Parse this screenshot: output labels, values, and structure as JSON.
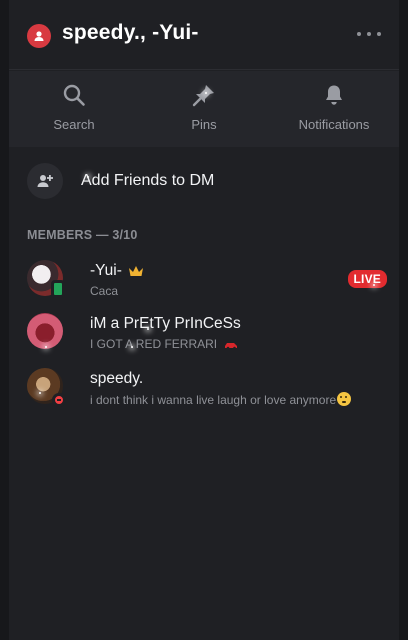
{
  "header": {
    "title": "speedy., -Yui-",
    "group_icon": "group-dm-icon",
    "more_icon": "more-options-icon"
  },
  "actions": [
    {
      "label": "Search",
      "icon": "search-icon"
    },
    {
      "label": "Pins",
      "icon": "pin-icon"
    },
    {
      "label": "Notifications",
      "icon": "bell-icon"
    }
  ],
  "add_friends": {
    "label": "Add Friends to DM",
    "icon": "add-friend-icon"
  },
  "members_header": "MEMBERS — 3/10",
  "members": [
    {
      "name": "-Yui-",
      "subtitle": "Caca",
      "status": "mobile-online",
      "badge": "LIVE",
      "name_icon": "crown-icon"
    },
    {
      "name": "iM a PrEtTy PrInCeSs",
      "subtitle": "I GOT A RED FERRARI",
      "status": "none",
      "subtitle_icon": "red-car-icon"
    },
    {
      "name": "speedy.",
      "subtitle": "i dont think i wanna live laugh or love anymore",
      "status": "do-not-disturb",
      "subtitle_icon": "grimace-emoji-icon"
    }
  ],
  "colors": {
    "background": "#1f2024",
    "action_bar": "#25262b",
    "live_red": "#e22b2f",
    "online_green": "#23a55a",
    "dnd_red": "#f23f43"
  }
}
